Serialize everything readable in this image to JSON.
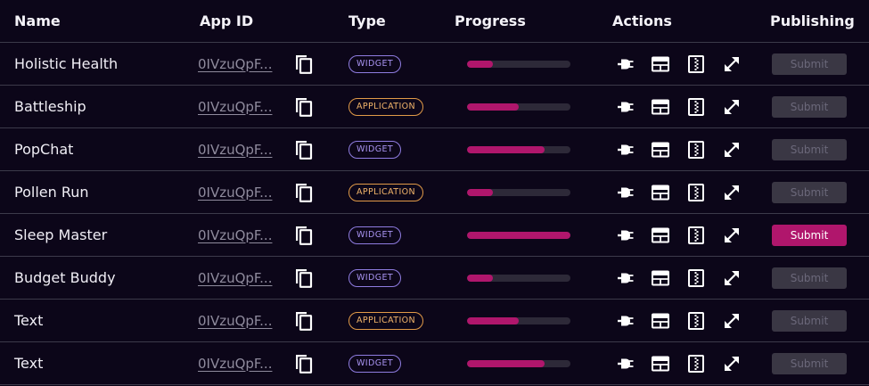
{
  "header": {
    "name": "Name",
    "app_id": "App ID",
    "type": "Type",
    "progress": "Progress",
    "actions": "Actions",
    "publishing": "Publishing"
  },
  "colors": {
    "background": "#0c0619",
    "accent": "#b0166c",
    "widget_badge": "#8f7ce0",
    "application_badge": "#e19a48"
  },
  "icons": {
    "copy": "copy-icon",
    "plug": "plug-icon",
    "layout": "layout-icon",
    "zipper": "archive-icon",
    "expand": "expand-icon"
  },
  "rows": [
    {
      "name": "Holistic Health",
      "app_id": "0IVzuQpF...",
      "type": "WIDGET",
      "progress": 0.25,
      "submit": "Submit",
      "submit_enabled": false
    },
    {
      "name": "Battleship",
      "app_id": "0IVzuQpF...",
      "type": "APPLICATION",
      "progress": 0.5,
      "submit": "Submit",
      "submit_enabled": false
    },
    {
      "name": "PopChat",
      "app_id": "0IVzuQpF...",
      "type": "WIDGET",
      "progress": 0.75,
      "submit": "Submit",
      "submit_enabled": false
    },
    {
      "name": "Pollen Run",
      "app_id": "0IVzuQpF...",
      "type": "APPLICATION",
      "progress": 0.25,
      "submit": "Submit",
      "submit_enabled": false
    },
    {
      "name": "Sleep Master",
      "app_id": "0IVzuQpF...",
      "type": "WIDGET",
      "progress": 1.0,
      "submit": "Submit",
      "submit_enabled": true
    },
    {
      "name": "Budget Buddy",
      "app_id": "0IVzuQpF...",
      "type": "WIDGET",
      "progress": 0.25,
      "submit": "Submit",
      "submit_enabled": false
    },
    {
      "name": "Text",
      "app_id": "0IVzuQpF...",
      "type": "APPLICATION",
      "progress": 0.5,
      "submit": "Submit",
      "submit_enabled": false
    },
    {
      "name": "Text",
      "app_id": "0IVzuQpF...",
      "type": "WIDGET",
      "progress": 0.75,
      "submit": "Submit",
      "submit_enabled": false
    }
  ]
}
